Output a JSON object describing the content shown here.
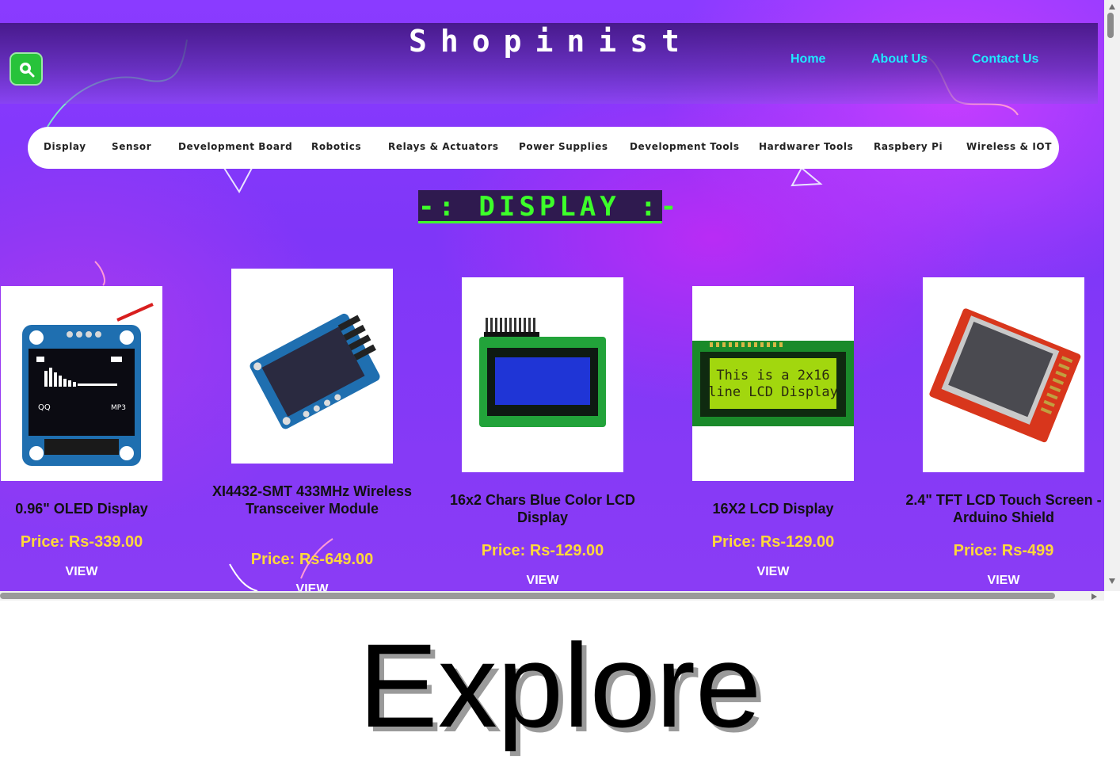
{
  "brand": {
    "title": "Shopinist"
  },
  "topnav": {
    "home": "Home",
    "about": "About Us",
    "contact": "Contact Us"
  },
  "search": {
    "icon": "search-icon"
  },
  "categories": [
    "Display",
    "Sensor",
    "Development Board",
    "Robotics",
    "Relays & Actuators",
    "Power Supplies",
    "Development Tools",
    "Hardwarer Tools",
    "Raspbery Pi",
    "Wireless & IOT"
  ],
  "section": {
    "title": "-: DISPLAY :-"
  },
  "products": [
    {
      "name": "0.96\" OLED Display",
      "price": "Price: Rs-339.00",
      "action": "VIEW",
      "oled": [
        "QQ",
        "MP3"
      ]
    },
    {
      "name": "XI4432-SMT 433MHz Wireless Transceiver Module",
      "price": "Price: Rs-649.00",
      "action": "VIEW"
    },
    {
      "name": "16x2 Chars Blue Color LCD Display",
      "price": "Price: Rs-129.00",
      "action": "VIEW"
    },
    {
      "name": "16X2 LCD Display",
      "price": "Price: Rs-129.00",
      "action": "VIEW",
      "lcd_text": [
        "This is a 2x16",
        "line LCD Display"
      ]
    },
    {
      "name": "2.4\" TFT LCD Touch Screen - Arduino Shield",
      "price": "Price: Rs-499",
      "action": "VIEW"
    }
  ],
  "caption": "Explore",
  "colors": {
    "accent_green": "#3dff2a",
    "link_cyan": "#1fe8ff",
    "price_yellow": "#ffd83a",
    "bg_purple": "#8a3bff"
  }
}
